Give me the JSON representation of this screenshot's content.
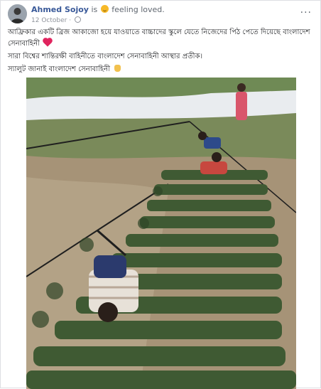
{
  "post": {
    "author": "Ahmed Sojoy",
    "is_text": "is",
    "feeling_text": "feeling loved.",
    "timestamp": "12 October",
    "separator": "·",
    "more_label": "···"
  },
  "body": {
    "line1": "আফ্রিকার একটি ব্রিজ আকাজো হয়ে যাওয়াতে বাচ্চাদের স্কুলে যেতে নিজেদের পিঠ পেতে দিয়েছে বাংলাদেশ সেনাবাহিনী",
    "line2": "সারা বিশ্বের শান্তিরক্ষী বাহিনীতে বাংলাদেশ সেনাবাহিনী আস্থার প্রতীক।",
    "line3": "স্যালুট জানাই বাংলাদেশ সেনাবাহিনী"
  },
  "icons": {
    "avatar": "avatar",
    "feeling": "smiling-face-icon",
    "globe": "globe-icon",
    "heart": "heart-icon",
    "salute": "salute-hand-icon",
    "more": "more-options-icon"
  }
}
